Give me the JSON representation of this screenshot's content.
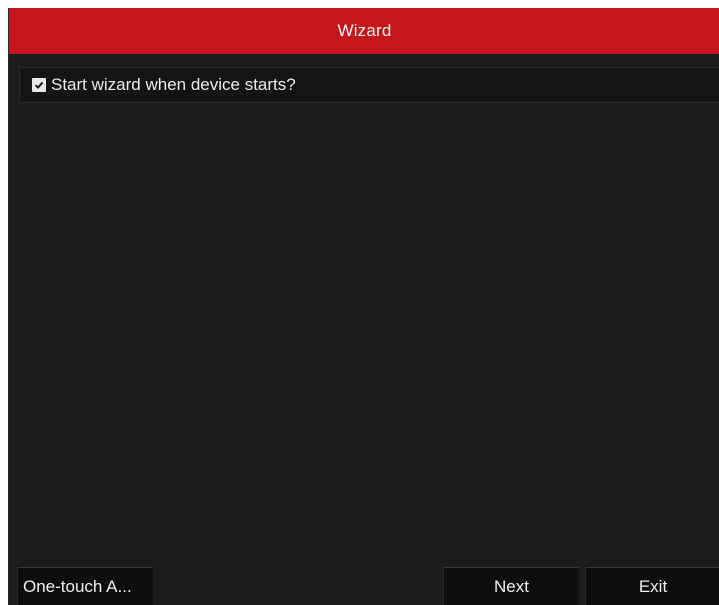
{
  "window": {
    "title": "Wizard"
  },
  "options": {
    "start_wizard": {
      "label": "Start wizard when device starts?",
      "checked": true,
      "icon": "checkbox-checked-icon"
    }
  },
  "footer": {
    "one_touch_label": "One-touch A...",
    "next_label": "Next",
    "exit_label": "Exit"
  },
  "colors": {
    "titlebar": "#c4161c",
    "background": "#1c1c1c",
    "button": "#0e0e0e",
    "text": "#e6e6e6"
  }
}
